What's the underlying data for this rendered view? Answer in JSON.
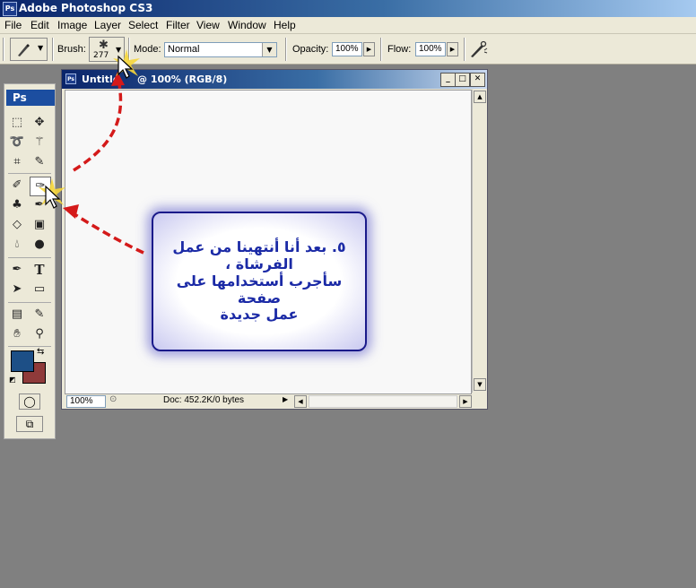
{
  "app": {
    "title": "Adobe Photoshop CS3",
    "logo_text": "Ps"
  },
  "menu": [
    "File",
    "Edit",
    "Image",
    "Layer",
    "Select",
    "Filter",
    "View",
    "Window",
    "Help"
  ],
  "options": {
    "brush_label": "Brush:",
    "brush_size": "277",
    "mode_label": "Mode:",
    "mode_value": "Normal",
    "opacity_label": "Opacity:",
    "opacity_value": "100%",
    "flow_label": "Flow:",
    "flow_value": "100%"
  },
  "toolbox": {
    "logo_text": "Ps",
    "type_tool_glyph": "T"
  },
  "document": {
    "title_prefix": "Untitle",
    "title_suffix": "@ 100% (RGB/8)",
    "zoom": "100%",
    "doc_info": "Doc: 452.2K/0 bytes"
  },
  "callout": {
    "line1": "٥. بعد أنا أنتهينا من عمل الفرشاة ،",
    "line2": "سأجرب أستخدامها على صفحة",
    "line3": "عمل جديدة"
  },
  "colors": {
    "foreground": "#1d4f86",
    "background": "#8f3a3a",
    "callout_text": "#1b2aa6",
    "arrow": "#d41a1a"
  },
  "icons": {
    "brush": "brush-icon",
    "airbrush": "airbrush-icon",
    "cursor": "arrow-cursor-icon"
  }
}
